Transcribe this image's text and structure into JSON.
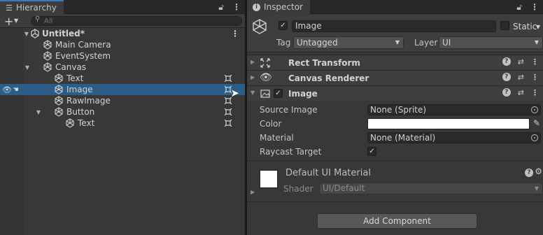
{
  "hierarchy": {
    "tab_title": "Hierarchy",
    "search_placeholder": "All",
    "scene": "Untitled*",
    "items": [
      {
        "label": "Main Camera"
      },
      {
        "label": "EventSystem"
      },
      {
        "label": "Canvas"
      },
      {
        "label": "Text"
      },
      {
        "label": "Image"
      },
      {
        "label": "RawImage"
      },
      {
        "label": "Button"
      },
      {
        "label": "Text"
      }
    ]
  },
  "inspector": {
    "tab_title": "Inspector",
    "object_name": "Image",
    "static_label": "Static",
    "tag_label": "Tag",
    "tag_value": "Untagged",
    "layer_label": "Layer",
    "layer_value": "UI",
    "components": [
      {
        "title": "Rect Transform"
      },
      {
        "title": "Canvas Renderer"
      },
      {
        "title": "Image"
      }
    ],
    "image_props": {
      "source_image_label": "Source Image",
      "source_image_value": "None (Sprite)",
      "color_label": "Color",
      "color_value": "#ffffff",
      "material_label": "Material",
      "material_value": "None (Material)",
      "raycast_label": "Raycast Target",
      "raycast_checked": true
    },
    "material": {
      "name": "Default UI Material",
      "shader_label": "Shader",
      "shader_value": "UI/Default"
    },
    "add_component_label": "Add Component"
  },
  "colors": {
    "selection": "#2c5d87",
    "accent": "#3a79bb",
    "background": "#383838"
  }
}
